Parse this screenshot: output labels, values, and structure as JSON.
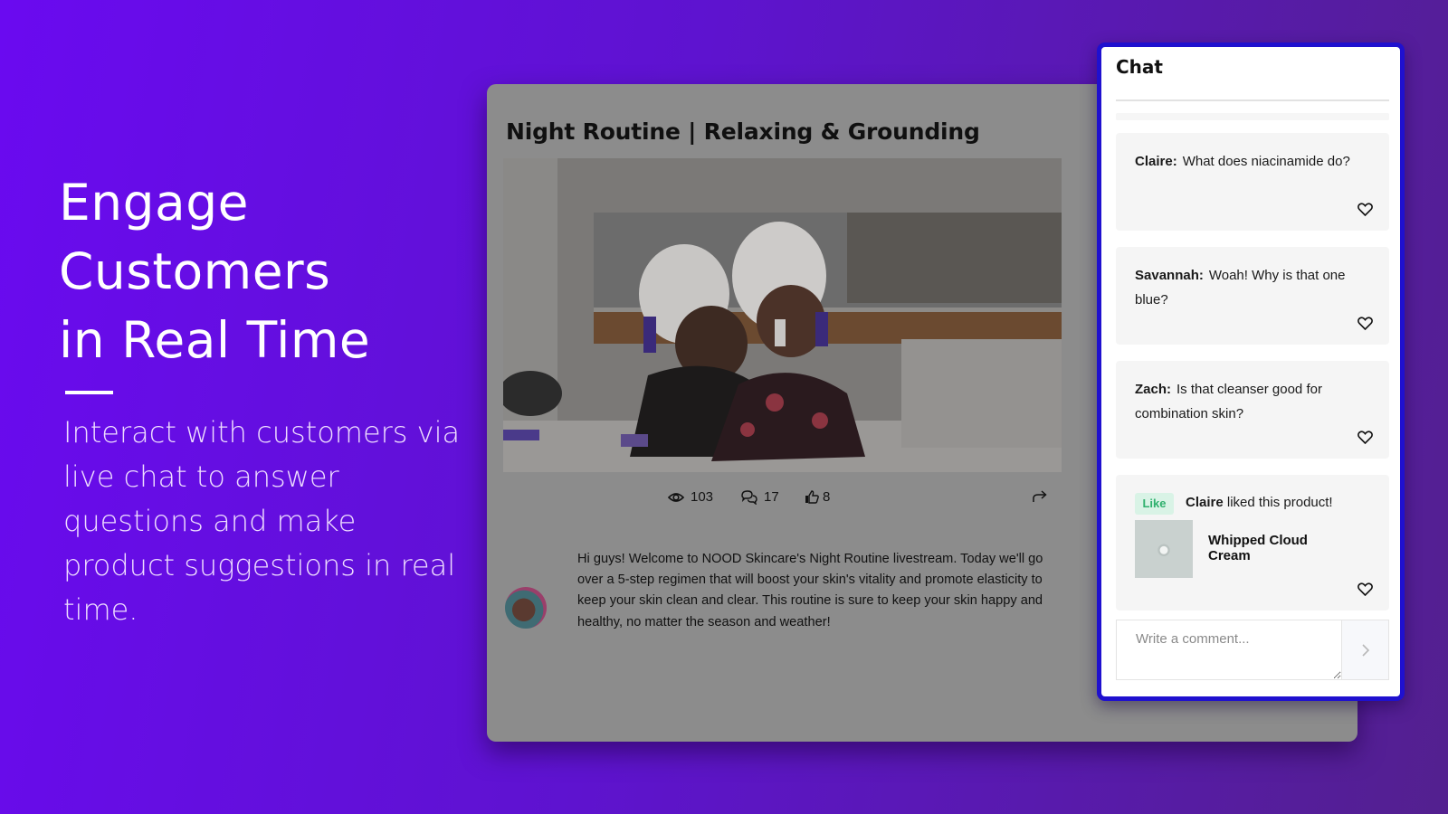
{
  "hero": {
    "title_lines": [
      "Engage",
      "Customers",
      "in Real Time"
    ],
    "subtitle": "Interact with customers via live chat to answer questions and make product suggestions in real time."
  },
  "stream": {
    "title": "Night Routine | Relaxing & Grounding",
    "video_icon": "video-thumbnail-image",
    "stats": {
      "views": "103",
      "views_icon": "eye-icon",
      "comments": "17",
      "comments_icon": "chat-bubbles-icon",
      "likes": "8",
      "likes_icon": "thumbs-up-icon",
      "share_icon": "share-arrow-icon"
    },
    "description": "Hi guys! Welcome to NOOD Skincare's Night Routine livestream. Today we'll go over a 5-step regimen that will boost your skin's vitality and promote elasticity to keep your skin clean and clear. This routine is sure to keep your skin happy and healthy, no matter the season and weather!"
  },
  "chat": {
    "title": "Chat",
    "messages": [
      {
        "user": "Claire:",
        "text": "What does niacinamide do?"
      },
      {
        "user": "Savannah:",
        "text": "Woah! Why is that one blue?"
      },
      {
        "user": "Zach:",
        "text": "Is that cleanser good for combination skin?"
      }
    ],
    "like_event": {
      "badge": "Like",
      "user": "Claire",
      "text": " liked this product!",
      "product_name": "Whipped Cloud Cream"
    },
    "comment_placeholder": "Write a comment...",
    "send_icon": "chevron-right-icon"
  },
  "colors": {
    "accent_purple": "#6a0af0",
    "chat_border": "#1f10cf",
    "like_badge_bg": "#d9f3e6",
    "like_badge_text": "#2fb06d"
  }
}
